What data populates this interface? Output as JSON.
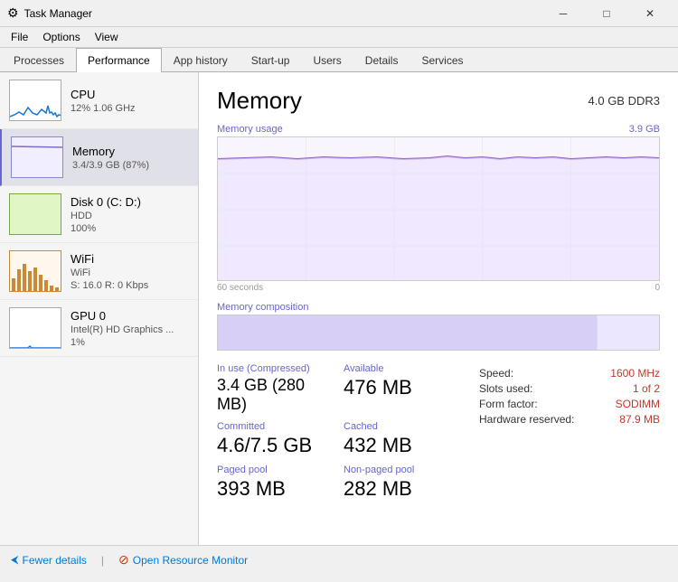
{
  "titleBar": {
    "icon": "⚙",
    "title": "Task Manager",
    "minimizeLabel": "─",
    "maximizeLabel": "□",
    "closeLabel": "✕"
  },
  "menuBar": {
    "items": [
      "File",
      "Options",
      "View"
    ]
  },
  "tabs": [
    {
      "id": "processes",
      "label": "Processes"
    },
    {
      "id": "performance",
      "label": "Performance",
      "active": true
    },
    {
      "id": "apphistory",
      "label": "App history"
    },
    {
      "id": "startup",
      "label": "Start-up"
    },
    {
      "id": "users",
      "label": "Users"
    },
    {
      "id": "details",
      "label": "Details"
    },
    {
      "id": "services",
      "label": "Services"
    }
  ],
  "sidebar": {
    "items": [
      {
        "id": "cpu",
        "name": "CPU",
        "sub1": "12% 1.06 GHz",
        "chartType": "cpu",
        "active": false
      },
      {
        "id": "memory",
        "name": "Memory",
        "sub1": "3.4/3.9 GB (87%)",
        "chartType": "memory",
        "active": true
      },
      {
        "id": "disk",
        "name": "Disk 0 (C: D:)",
        "sub1": "HDD",
        "sub2": "100%",
        "chartType": "disk",
        "active": false
      },
      {
        "id": "wifi",
        "name": "WiFi",
        "sub1": "WiFi",
        "sub2": "S: 16.0  R: 0 Kbps",
        "chartType": "wifi",
        "active": false
      },
      {
        "id": "gpu",
        "name": "GPU 0",
        "sub1": "Intel(R) HD Graphics ...",
        "sub2": "1%",
        "chartType": "gpu",
        "active": false
      }
    ]
  },
  "detail": {
    "title": "Memory",
    "subtitle": "4.0 GB DDR3",
    "graphLabel": "Memory usage",
    "graphMax": "3.9 GB",
    "graphMin": "0",
    "timeLabel": "60 seconds",
    "compositionLabel": "Memory composition",
    "stats": {
      "inUse": {
        "label": "In use (Compressed)",
        "value": "3.4 GB (280 MB)"
      },
      "available": {
        "label": "Available",
        "value": "476 MB"
      },
      "committed": {
        "label": "Committed",
        "value": "4.6/7.5 GB"
      },
      "cached": {
        "label": "Cached",
        "value": "432 MB"
      },
      "pagedPool": {
        "label": "Paged pool",
        "value": "393 MB"
      },
      "nonPagedPool": {
        "label": "Non-paged pool",
        "value": "282 MB"
      }
    },
    "rightStats": {
      "speed": {
        "label": "Speed:",
        "value": "1600 MHz"
      },
      "slotsUsed": {
        "label": "Slots used:",
        "value": "1 of 2"
      },
      "formFactor": {
        "label": "Form factor:",
        "value": "SODIMM"
      },
      "hwReserved": {
        "label": "Hardware reserved:",
        "value": "87.9 MB"
      }
    }
  },
  "bottomBar": {
    "fewerDetails": "Fewer details",
    "openResourceMonitor": "Open Resource Monitor"
  }
}
